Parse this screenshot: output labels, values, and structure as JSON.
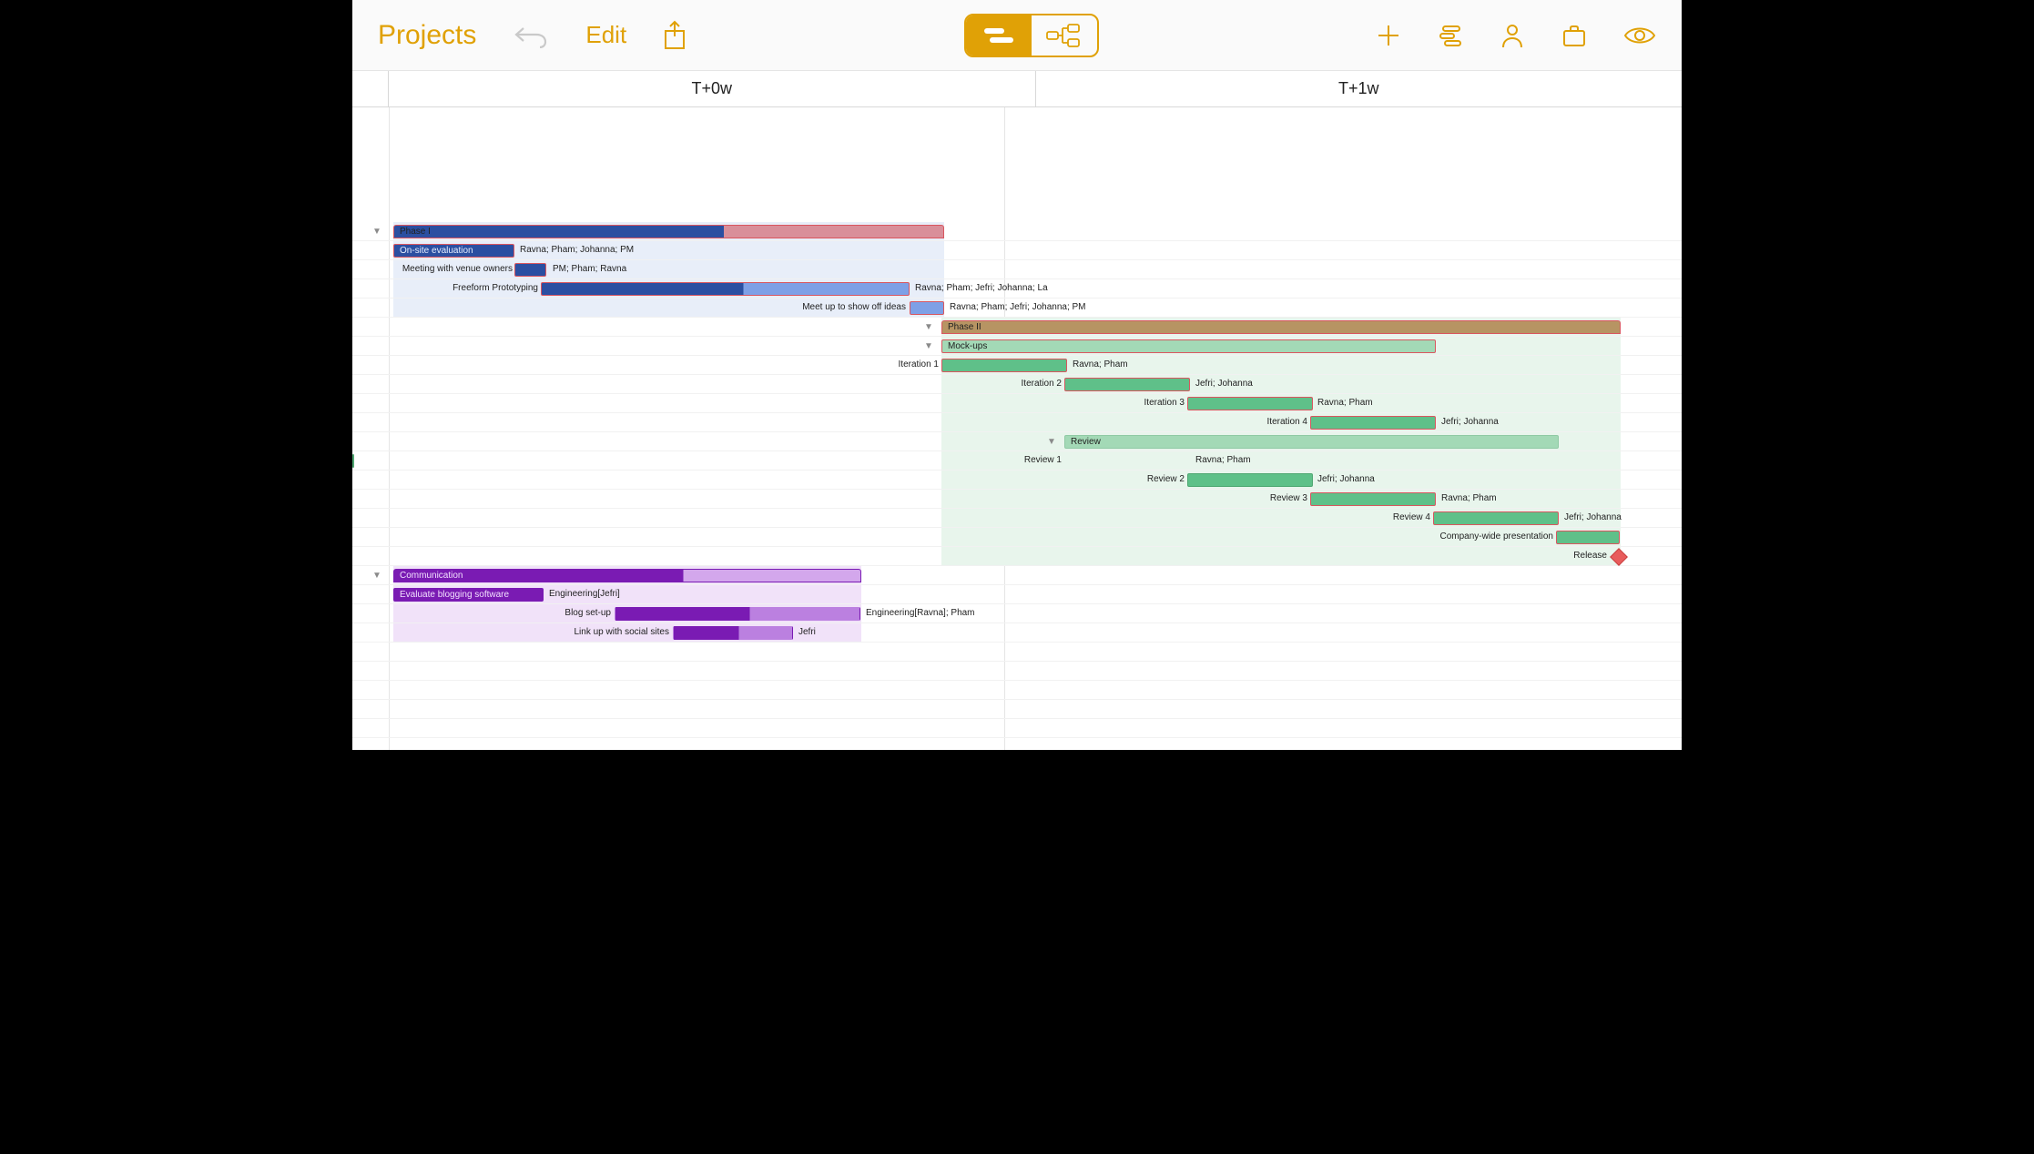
{
  "toolbar": {
    "back_label": "Projects",
    "edit_label": "Edit"
  },
  "timeline": {
    "columns": [
      "T+0w",
      "T+1w"
    ]
  },
  "colors": {
    "accent": "#e0a106",
    "blue_dark": "#2b4fa1",
    "blue_light": "#7ea0e6",
    "green_dark": "#5fc089",
    "green_light": "#a3d9b6",
    "green_group": "#b79463",
    "purple_dark": "#7a1bb3",
    "purple_light": "#bb80e0",
    "critical_outline": "#d9565f"
  },
  "phase1": {
    "title": "Phase I",
    "tasks": [
      {
        "name": "On-site evaluation",
        "assignees": "Ravna; Pham; Johanna; PM"
      },
      {
        "name": "Meeting with venue owners",
        "assignees": "PM; Pham; Ravna"
      },
      {
        "name": "Freeform Prototyping",
        "assignees": "Ravna; Pham; Jefri; Johanna; La"
      },
      {
        "name": "Meet up to show off ideas",
        "assignees": "Ravna; Pham; Jefri; Johanna; PM"
      }
    ]
  },
  "phase2": {
    "title": "Phase II",
    "mockups": {
      "title": "Mock-ups",
      "iterations": [
        {
          "name": "Iteration 1",
          "assignees": "Ravna; Pham"
        },
        {
          "name": "Iteration 2",
          "assignees": "Jefri; Johanna"
        },
        {
          "name": "Iteration 3",
          "assignees": "Ravna; Pham"
        },
        {
          "name": "Iteration 4",
          "assignees": "Jefri; Johanna"
        }
      ]
    },
    "review": {
      "title": "Review",
      "items": [
        {
          "name": "Review 1",
          "assignees": "Ravna; Pham"
        },
        {
          "name": "Review 2",
          "assignees": "Jefri; Johanna"
        },
        {
          "name": "Review 3",
          "assignees": "Ravna; Pham"
        },
        {
          "name": "Review 4",
          "assignees": "Jefri; Johanna"
        }
      ]
    },
    "presentation": "Company-wide presentation",
    "milestone": "Release"
  },
  "communication": {
    "title": "Communication",
    "tasks": [
      {
        "name": "Evaluate blogging software",
        "assignees": "Engineering[Jefri]"
      },
      {
        "name": "Blog set-up",
        "assignees": "Engineering[Ravna]; Pham"
      },
      {
        "name": "Link up with social sites",
        "assignees": "Jefri"
      }
    ]
  }
}
